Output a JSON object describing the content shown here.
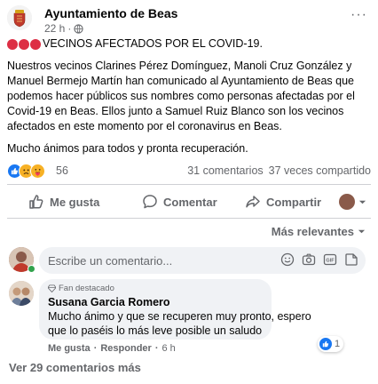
{
  "post": {
    "page_name": "Ayuntamiento de Beas",
    "time": "22 h",
    "separator": "·",
    "more_label": "···",
    "headline": "VECINOS AFECTADOS POR EL COVID-19.",
    "paragraph1": "Nuestros vecinos Clarines Pérez Domínguez, Manoli Cruz González y Manuel Bermejo Martín han comunicado al Ayuntamiento de Beas que podemos hacer públicos sus nombres como personas afectadas por el Covid-19 en Beas. Ellos junto a Samuel Ruiz Blanco son los vecinos afectados en este momento por el coronavirus en Beas.",
    "paragraph2": "Mucho ánimos para todos y pronta recuperación.",
    "headline_icons": [
      "red-circle",
      "red-circle",
      "red-circle"
    ]
  },
  "reactions": {
    "icons": [
      "like-icon",
      "sad-icon",
      "care-icon"
    ],
    "count": "56",
    "comments": "31 comentarios",
    "shares": "37 veces compartido"
  },
  "actions": {
    "like": "Me gusta",
    "comment": "Comentar",
    "share": "Compartir"
  },
  "comments_section": {
    "sort_label": "Más relevantes",
    "composer_placeholder": "Escribe un comentario...",
    "view_more": "Ver 29 comentarios más"
  },
  "comment": {
    "badge": "Fan destacado",
    "author": "Susana Garcia Romero",
    "text": "Mucho ánimo y que se recuperen muy pronto, espero que lo paséis lo más leve posible un saludo",
    "like": "Me gusta",
    "dot": "·",
    "reply": "Responder",
    "time": "6 h",
    "reaction_count": "1"
  },
  "colors": {
    "accent": "#1877f2",
    "red_dot": "#dd2e44",
    "online": "#31a24c"
  }
}
